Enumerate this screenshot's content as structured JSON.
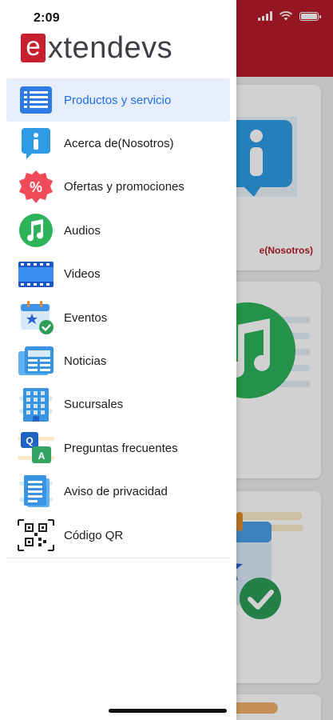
{
  "status_bar": {
    "time": "2:09"
  },
  "brand": {
    "logo_letter": "e",
    "logo_rest": "xtendevs",
    "logo_color": "#c8202f"
  },
  "menu": {
    "items": [
      {
        "label": "Productos y servicio",
        "icon": "list-icon",
        "selected": true
      },
      {
        "label": "Acerca de(Nosotros)",
        "icon": "info-icon",
        "selected": false
      },
      {
        "label": "Ofertas y promociones",
        "icon": "percent-badge-icon",
        "selected": false
      },
      {
        "label": "Audios",
        "icon": "music-note-icon",
        "selected": false
      },
      {
        "label": "Videos",
        "icon": "film-strip-icon",
        "selected": false
      },
      {
        "label": "Eventos",
        "icon": "calendar-star-icon",
        "selected": false
      },
      {
        "label": "Noticias",
        "icon": "newspaper-icon",
        "selected": false
      },
      {
        "label": "Sucursales",
        "icon": "building-icon",
        "selected": false
      },
      {
        "label": "Preguntas frecuentes",
        "icon": "qa-icon",
        "selected": false
      },
      {
        "label": "Aviso de privacidad",
        "icon": "document-icon",
        "selected": false
      },
      {
        "label": "Código QR",
        "icon": "qr-code-icon",
        "selected": false
      }
    ]
  },
  "background": {
    "header_color": "#b51c2b",
    "card_label_partial": "e(Nosotros)"
  },
  "colors": {
    "selected_bg": "#e6eefc",
    "selected_text": "#1f6fe0"
  }
}
